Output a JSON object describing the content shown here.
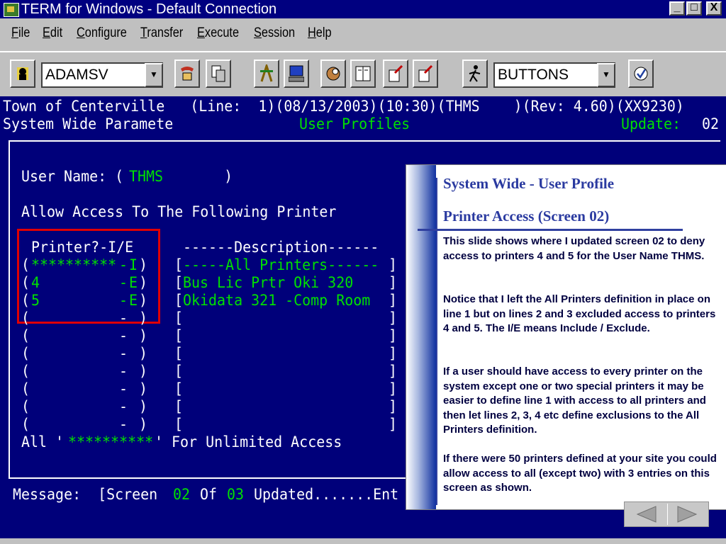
{
  "window": {
    "title": "TERM for Windows - Default Connection",
    "controls": {
      "minimize": "_",
      "maximize": "□",
      "close": "X"
    }
  },
  "menu": {
    "items": [
      {
        "first": "F",
        "rest": "ile"
      },
      {
        "first": "E",
        "rest": "dit"
      },
      {
        "first": "C",
        "rest": "onfigure"
      },
      {
        "first": "T",
        "rest": "ransfer"
      },
      {
        "first": "E",
        "rest": "xecute"
      },
      {
        "first": "S",
        "rest": "ession"
      },
      {
        "first": "H",
        "rest": "elp"
      }
    ],
    "labels": [
      "File",
      "Edit",
      "Configure",
      "Transfer",
      "Execute",
      "Session",
      "Help"
    ]
  },
  "toolbar": {
    "connection_value": "ADAMSV",
    "buttons_value": "BUTTONS",
    "icons": [
      "phone-user-icon",
      "phone-icon",
      "copy-icon",
      "network-icon",
      "computer-icon",
      "baseball-icon",
      "book-icon",
      "send-icon",
      "receive-icon",
      "run-icon",
      "check-icon"
    ]
  },
  "terminal": {
    "header_line1": "Town of Centerville   (Line:  1)(08/13/2003)(10:30)(THMS    )(Rev: 4.60)(XX9230)",
    "header_left2": "System Wide Paramete",
    "header_center2": "User Profiles",
    "update_label": "Update:",
    "update_value": "02",
    "user_name_label": "User Name: (",
    "user_name_value": "THMS",
    "user_name_close": "      )",
    "allow_access": "Allow Access To The Following Printer",
    "col_printer": "Printer?-I/E",
    "col_description": "------Description------",
    "rows": [
      {
        "printer": "**********",
        "ie": "I",
        "description": "-----All Printers------"
      },
      {
        "printer": "4",
        "ie": "E",
        "description": "Bus Lic Prtr Oki 320"
      },
      {
        "printer": "5",
        "ie": "E",
        "description": "Okidata 321 -Comp Room"
      },
      {
        "printer": "",
        "ie": "",
        "description": ""
      },
      {
        "printer": "",
        "ie": "",
        "description": ""
      },
      {
        "printer": "",
        "ie": "",
        "description": ""
      },
      {
        "printer": "",
        "ie": "",
        "description": ""
      },
      {
        "printer": "",
        "ie": "",
        "description": ""
      },
      {
        "printer": "",
        "ie": "",
        "description": ""
      },
      {
        "printer": "",
        "ie": "",
        "description": ""
      }
    ],
    "footer_all": "All '",
    "footer_stars": "**********",
    "footer_rest": "' For Unlimited Access",
    "message_label": "Message:  [Screen ",
    "message_num1": "02",
    "message_of": " Of ",
    "message_num2": "03",
    "message_rest": " Updated.......Ent"
  },
  "panel": {
    "title1": "System Wide - User Profile",
    "title2": "Printer Access (Screen 02)",
    "paragraphs": [
      "This slide shows where I updated screen 02 to deny access to printers 4 and 5 for the User Name THMS.",
      "Notice that I left the All Printers definition in place on line 1 but on lines 2 and 3 excluded access to printers 4 and 5.    The I/E means Include / Exclude.",
      "If a user should have access to every printer on the system except one or two special printers it may be easier to define line 1 with access to all printers and then let lines 2, 3, 4 etc define exclusions to the All Printers definition.",
      "If there were 50 printers defined at your site you could allow access to all (except two) with 3 entries on this screen as shown."
    ]
  },
  "colors": {
    "terminal_bg": "#00007a",
    "terminal_green": "#00e000",
    "highlight_red": "#e00000",
    "panel_heading": "#2a3aa0"
  }
}
